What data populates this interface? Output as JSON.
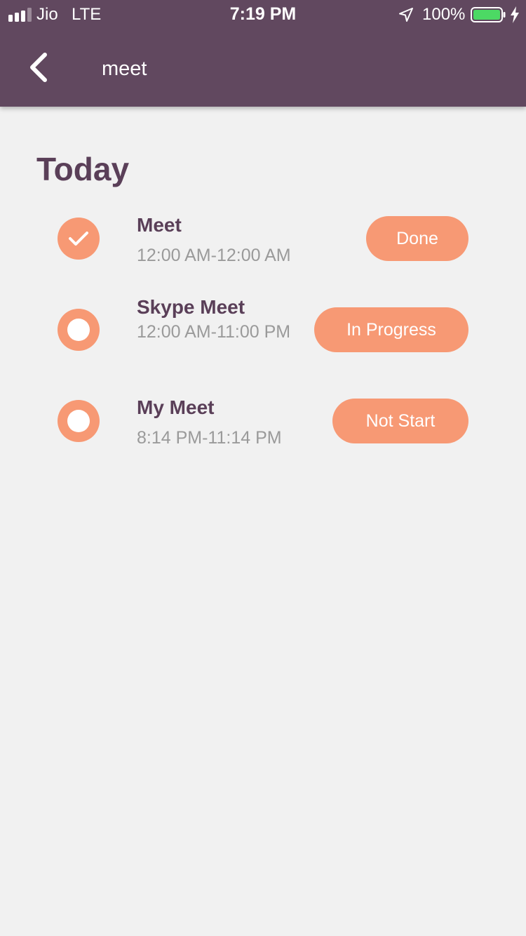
{
  "status_bar": {
    "carrier": "Jio",
    "network": "LTE",
    "time": "7:19 PM",
    "battery": "100%"
  },
  "header": {
    "title": "meet",
    "color": "#61485f"
  },
  "section_title": "Today",
  "meetings": [
    {
      "name": "Meet",
      "time": "12:00 AM-12:00 AM",
      "status": "Done",
      "checked": true
    },
    {
      "name": "Skype Meet",
      "time": "12:00 AM-11:00 PM",
      "status": "In Progress",
      "checked": false
    },
    {
      "name": "My Meet",
      "time": "8:14 PM-11:14 PM",
      "status": "Not Start",
      "checked": false
    }
  ],
  "colors": {
    "accent": "#f79974",
    "text_primary": "#5a3f58",
    "background": "#f1f1f1"
  }
}
